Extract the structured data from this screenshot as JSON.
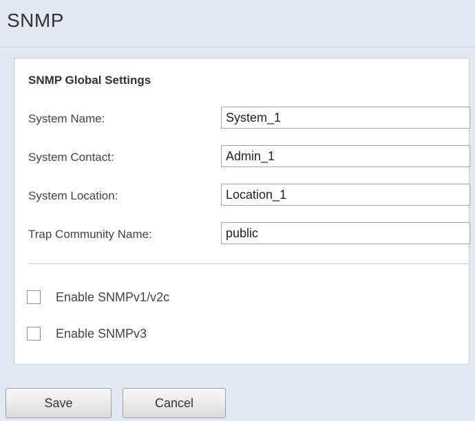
{
  "page": {
    "title": "SNMP"
  },
  "global_settings": {
    "section_title": "SNMP Global Settings",
    "fields": [
      {
        "label": "System Name:",
        "value": "System_1"
      },
      {
        "label": "System Contact:",
        "value": "Admin_1"
      },
      {
        "label": "System Location:",
        "value": "Location_1"
      },
      {
        "label": "Trap Community Name:",
        "value": "public"
      }
    ],
    "checkboxes": [
      {
        "label": "Enable SNMPv1/v2c",
        "checked": false
      },
      {
        "label": "Enable SNMPv3",
        "checked": false
      }
    ]
  },
  "buttons": {
    "save_label": "Save",
    "cancel_label": "Cancel"
  },
  "colors": {
    "page_background": "#e3e9f2",
    "panel_background": "#ffffff",
    "text": "#333333"
  }
}
